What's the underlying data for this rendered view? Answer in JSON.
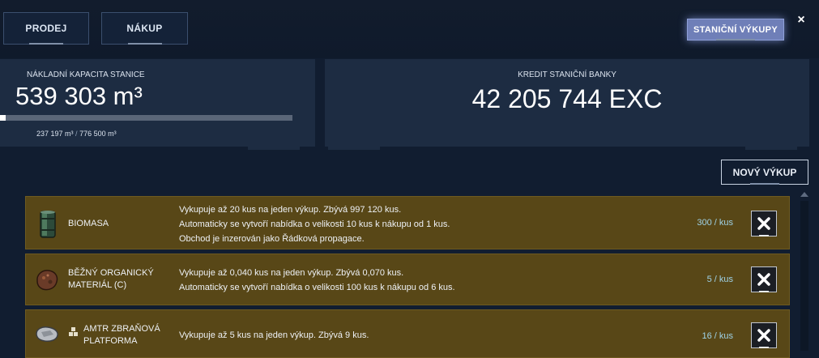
{
  "header": {
    "sell_label": "PRODEJ",
    "buy_label": "NÁKUP",
    "station_buyouts_label": "STANIČNÍ VÝKUPY",
    "close_label": "×"
  },
  "capacity": {
    "label": "NÁKLADNÍ KAPACITA STANICE",
    "value": "539 303 m³",
    "used": "237 197 m³",
    "separator": "/",
    "total": "776 500 m³",
    "fill_fraction": 0.02
  },
  "credit": {
    "label": "KREDIT STANIČNÍ BANKY",
    "value": "42 205 744 EXC"
  },
  "new_buyout_label": "NOVÝ VÝKUP",
  "buyouts": [
    {
      "name": "BIOMASA",
      "icon": "biomass-barrel-icon",
      "lines": [
        "Vykupuje až 20 kus na jeden výkup. Zbývá 997 120 kus.",
        "Automaticky se vytvoří nabídka o velikosti 10 kus k nákupu od 1 kus.",
        "Obchod je inzerován jako Řádková propagace."
      ],
      "price": "300 / kus"
    },
    {
      "name_line1": "BĚŽNÝ ORGANICKÝ",
      "name_line2": "MATERIÁL (C)",
      "icon": "organic-material-icon",
      "lines": [
        "Vykupuje až 0,040 kus na jeden výkup. Zbývá 0,070 kus.",
        "Automaticky se vytvoří nabídka o velikosti 100 kus k nákupu od 6 kus."
      ],
      "price": "5 / kus"
    },
    {
      "name_line1": "AMTR ZBRAŇOVÁ",
      "name_line2": "PLATFORMA",
      "icon": "weapon-platform-icon",
      "lines": [
        "Vykupuje až 5 kus na jeden výkup. Zbývá 9 kus."
      ],
      "price": "16 / kus"
    }
  ],
  "colors": {
    "row_background": "#584717",
    "accent_button": "#6f7fb8",
    "price_text": "#9fd2e6"
  }
}
